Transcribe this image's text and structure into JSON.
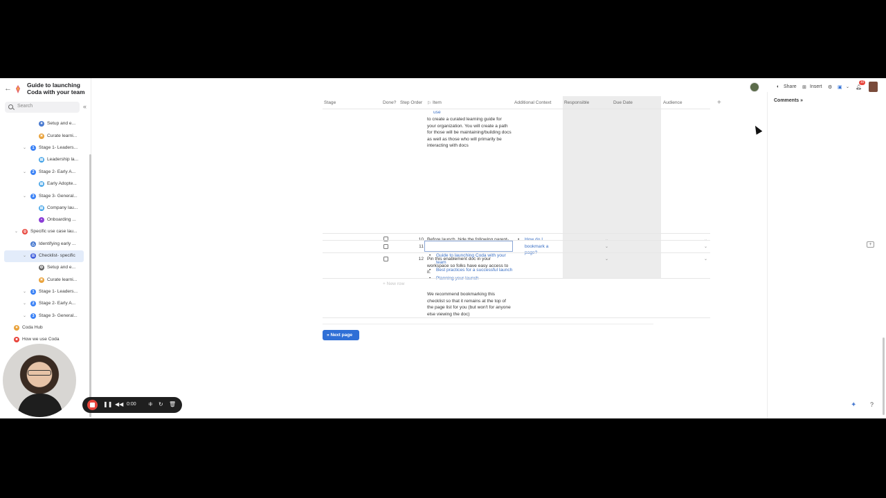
{
  "doc": {
    "title": "Guide to launching Coda with your team"
  },
  "search": {
    "placeholder": "Search"
  },
  "sidebar": {
    "items": [
      {
        "label": "Setup and e...",
        "icon_color": "#4a7bd0",
        "glyph": "✦"
      },
      {
        "label": "Curate learni...",
        "icon_color": "#e9a23b",
        "glyph": "☀"
      },
      {
        "label": "Stage 1- Leaders...",
        "icon_color": "#3b82f6",
        "glyph": "1"
      },
      {
        "label": "Leadership la...",
        "icon_color": "#3b9fe6",
        "glyph": "▤"
      },
      {
        "label": "Stage 2- Early A...",
        "icon_color": "#3b82f6",
        "glyph": "2"
      },
      {
        "label": "Early Adopte...",
        "icon_color": "#3b9fe6",
        "glyph": "▤"
      },
      {
        "label": "Stage 3- General...",
        "icon_color": "#3b82f6",
        "glyph": "3"
      },
      {
        "label": "Company lau...",
        "icon_color": "#3b9fe6",
        "glyph": "▤"
      },
      {
        "label": "Onboarding ...",
        "icon_color": "#8b3dd6",
        "glyph": "•"
      },
      {
        "label": "Specific use case lau...",
        "icon_color": "#e8453c",
        "glyph": "◎"
      },
      {
        "label": "Identifying early ...",
        "icon_color": "#4a7bd0",
        "glyph": "△"
      },
      {
        "label": "Checklist- specific",
        "icon_color": "#3b5bdb",
        "glyph": "☰"
      },
      {
        "label": "Setup and e...",
        "icon_color": "#666666",
        "glyph": "⚙"
      },
      {
        "label": "Curate learni...",
        "icon_color": "#e9a23b",
        "glyph": "☀"
      },
      {
        "label": "Stage 1- Leaders...",
        "icon_color": "#3b82f6",
        "glyph": "1"
      },
      {
        "label": "Stage 2- Early A...",
        "icon_color": "#3b82f6",
        "glyph": "2"
      },
      {
        "label": "Stage 3- General...",
        "icon_color": "#3b82f6",
        "glyph": "3"
      },
      {
        "label": "Coda Hub",
        "icon_color": "#e9a23b",
        "glyph": "✦"
      },
      {
        "label": "How we use Coda",
        "icon_color": "#e8453c",
        "glyph": "■"
      }
    ]
  },
  "topbar": {
    "share": "Share",
    "insert": "Insert",
    "notification_count": "10"
  },
  "comments": {
    "title": "Comments »"
  },
  "table": {
    "headers": {
      "stage": "Stage",
      "done": "Done?",
      "step_order": "Step Order",
      "item": "Item",
      "context": "Additional Context",
      "responsible": "Responsible",
      "due_date": "Due Date",
      "audience": "Audience"
    },
    "row9": {
      "item_top": "use",
      "item_text": "to create a curated learning guide for your organization. You will create a path for those will be maintaining/building docs as well as those who will primarily be interacting with docs"
    },
    "row10": {
      "num": "10",
      "item_intro": "Before launch, hide the following parent-level pages:",
      "links": [
        "Guide to launching Coda with your team",
        "Best practices for a successful launch",
        "Planning your launch"
      ],
      "item_outro": "We recommend bookmarking this checklist so that it remains at the top of the page list for you (but won't for anyone else viewing the doc)",
      "context_link": "How do I bookmark a page?"
    },
    "row11": {
      "num": "11"
    },
    "row12": {
      "num": "12",
      "item_text": "Pin this enablement doc in your workspace so folks have easy access to it."
    },
    "new_row": "+ New row"
  },
  "next_page": {
    "label": "» Next page"
  },
  "recorder": {
    "time": "0:00"
  }
}
